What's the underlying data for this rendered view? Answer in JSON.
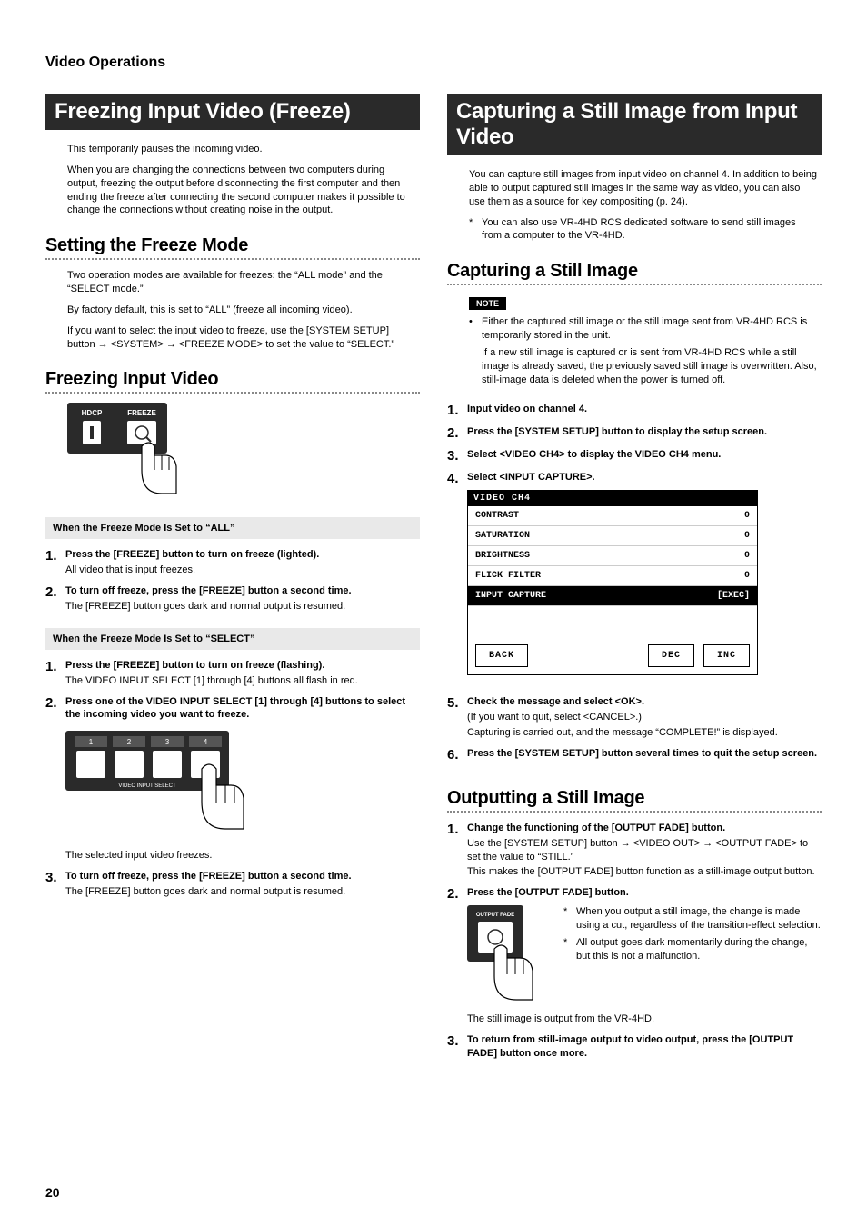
{
  "header": {
    "section": "Video Operations"
  },
  "left": {
    "title": "Freezing Input Video (Freeze)",
    "intro1": "This temporarily pauses the incoming video.",
    "intro2": "When you are changing the connections between two computers during output, freezing the output before disconnecting the first computer and then ending the freeze after connecting the second computer makes it possible to change the connections without creating noise in the output.",
    "sub1": {
      "title": "Setting the Freeze Mode",
      "p1": "Two operation modes are available for freezes: the “ALL mode” and the “SELECT mode.”",
      "p2": "By factory default, this is set to “ALL” (freeze all incoming video).",
      "p3": "If you want to select the input video to freeze, use the [SYSTEM SETUP] button → <SYSTEM> → <FREEZE MODE> to set the value to “SELECT.”"
    },
    "sub2": {
      "title": "Freezing Input Video",
      "stripA": "When the Freeze Mode Is Set to “ALL”",
      "a1_title": "Press the [FREEZE] button to turn on freeze (lighted).",
      "a1_text": "All video that is input freezes.",
      "a2_title": "To turn off freeze, press the [FREEZE] button a second time.",
      "a2_text": "The [FREEZE] button goes dark and normal output is resumed.",
      "stripB": "When the Freeze Mode Is Set to “SELECT”",
      "b1_title": "Press the [FREEZE] button to turn on freeze (flashing).",
      "b1_text": "The VIDEO INPUT SELECT [1] through [4] buttons all flash in red.",
      "b2_title": "Press one of the VIDEO INPUT SELECT [1] through [4] buttons to select the incoming video you want to freeze.",
      "b2_text": "The selected input video freezes.",
      "b3_title": "To turn off freeze, press the [FREEZE] button a second time.",
      "b3_text": "The [FREEZE] button goes dark and normal output is resumed."
    },
    "fig1": {
      "hdcp": "HDCP",
      "freeze": "FREEZE"
    },
    "fig2": {
      "label": "VIDEO INPUT SELECT",
      "btns": [
        "1",
        "2",
        "3",
        "4"
      ]
    }
  },
  "right": {
    "title": "Capturing a Still Image from Input Video",
    "intro1": "You can capture still images from input video on channel 4. In addition to being able to output captured still images in the same way as video, you can also use them as a source for key compositing (p. 24).",
    "intro2": "You can also use VR-4HD RCS dedicated software to send still images from a computer to the VR-4HD.",
    "sub1": {
      "title": "Capturing a Still Image",
      "note_label": "NOTE",
      "note_b1": "Either the captured still image or the still image sent from VR-4HD RCS is temporarily stored in the unit.",
      "note_b1_text": "If a new still image is captured or is sent from VR-4HD RCS while a still image is already saved, the previously saved still image is overwritten. Also, still-image data is deleted when the power is turned off.",
      "s1": "Input video on channel 4.",
      "s2": "Press the [SYSTEM SETUP] button to display the setup screen.",
      "s3": "Select <VIDEO CH4> to display the VIDEO CH4 menu.",
      "s4": "Select <INPUT CAPTURE>.",
      "s5_title": "Check the message and select <OK>.",
      "s5_text1": "(If you want to quit, select <CANCEL>.)",
      "s5_text2": "Capturing is carried out, and the message “COMPLETE!” is displayed.",
      "s6": "Press the [SYSTEM SETUP] button several times to quit the setup screen."
    },
    "menu": {
      "title": "VIDEO CH4",
      "rows": [
        {
          "k": "CONTRAST",
          "v": "0"
        },
        {
          "k": "SATURATION",
          "v": "0"
        },
        {
          "k": "BRIGHTNESS",
          "v": "0"
        },
        {
          "k": "FLICK FILTER",
          "v": "0"
        }
      ],
      "hl": {
        "k": "INPUT CAPTURE",
        "v": "[EXEC]"
      },
      "back": "BACK",
      "dec": "DEC",
      "inc": "INC"
    },
    "sub2": {
      "title": "Outputting a Still Image",
      "s1_title": "Change the functioning of the [OUTPUT FADE] button.",
      "s1_text1": "Use the [SYSTEM SETUP] button → <VIDEO OUT> → <OUTPUT FADE> to set the value to “STILL.”",
      "s1_text2": "This makes the [OUTPUT FADE] button function as a still-image output button.",
      "s2_title": "Press the [OUTPUT FADE] button.",
      "s2_a1": "When you output a still image, the change is made using a cut, regardless of the transition-effect selection.",
      "s2_a2": "All output goes dark momentarily during the change, but this is not a malfunction.",
      "s2_text": "The still image is output from the VR-4HD.",
      "s3_title": "To return from still-image output to video output, press the [OUTPUT FADE] button once more.",
      "fig_label": "OUTPUT FADE"
    }
  },
  "page": "20"
}
